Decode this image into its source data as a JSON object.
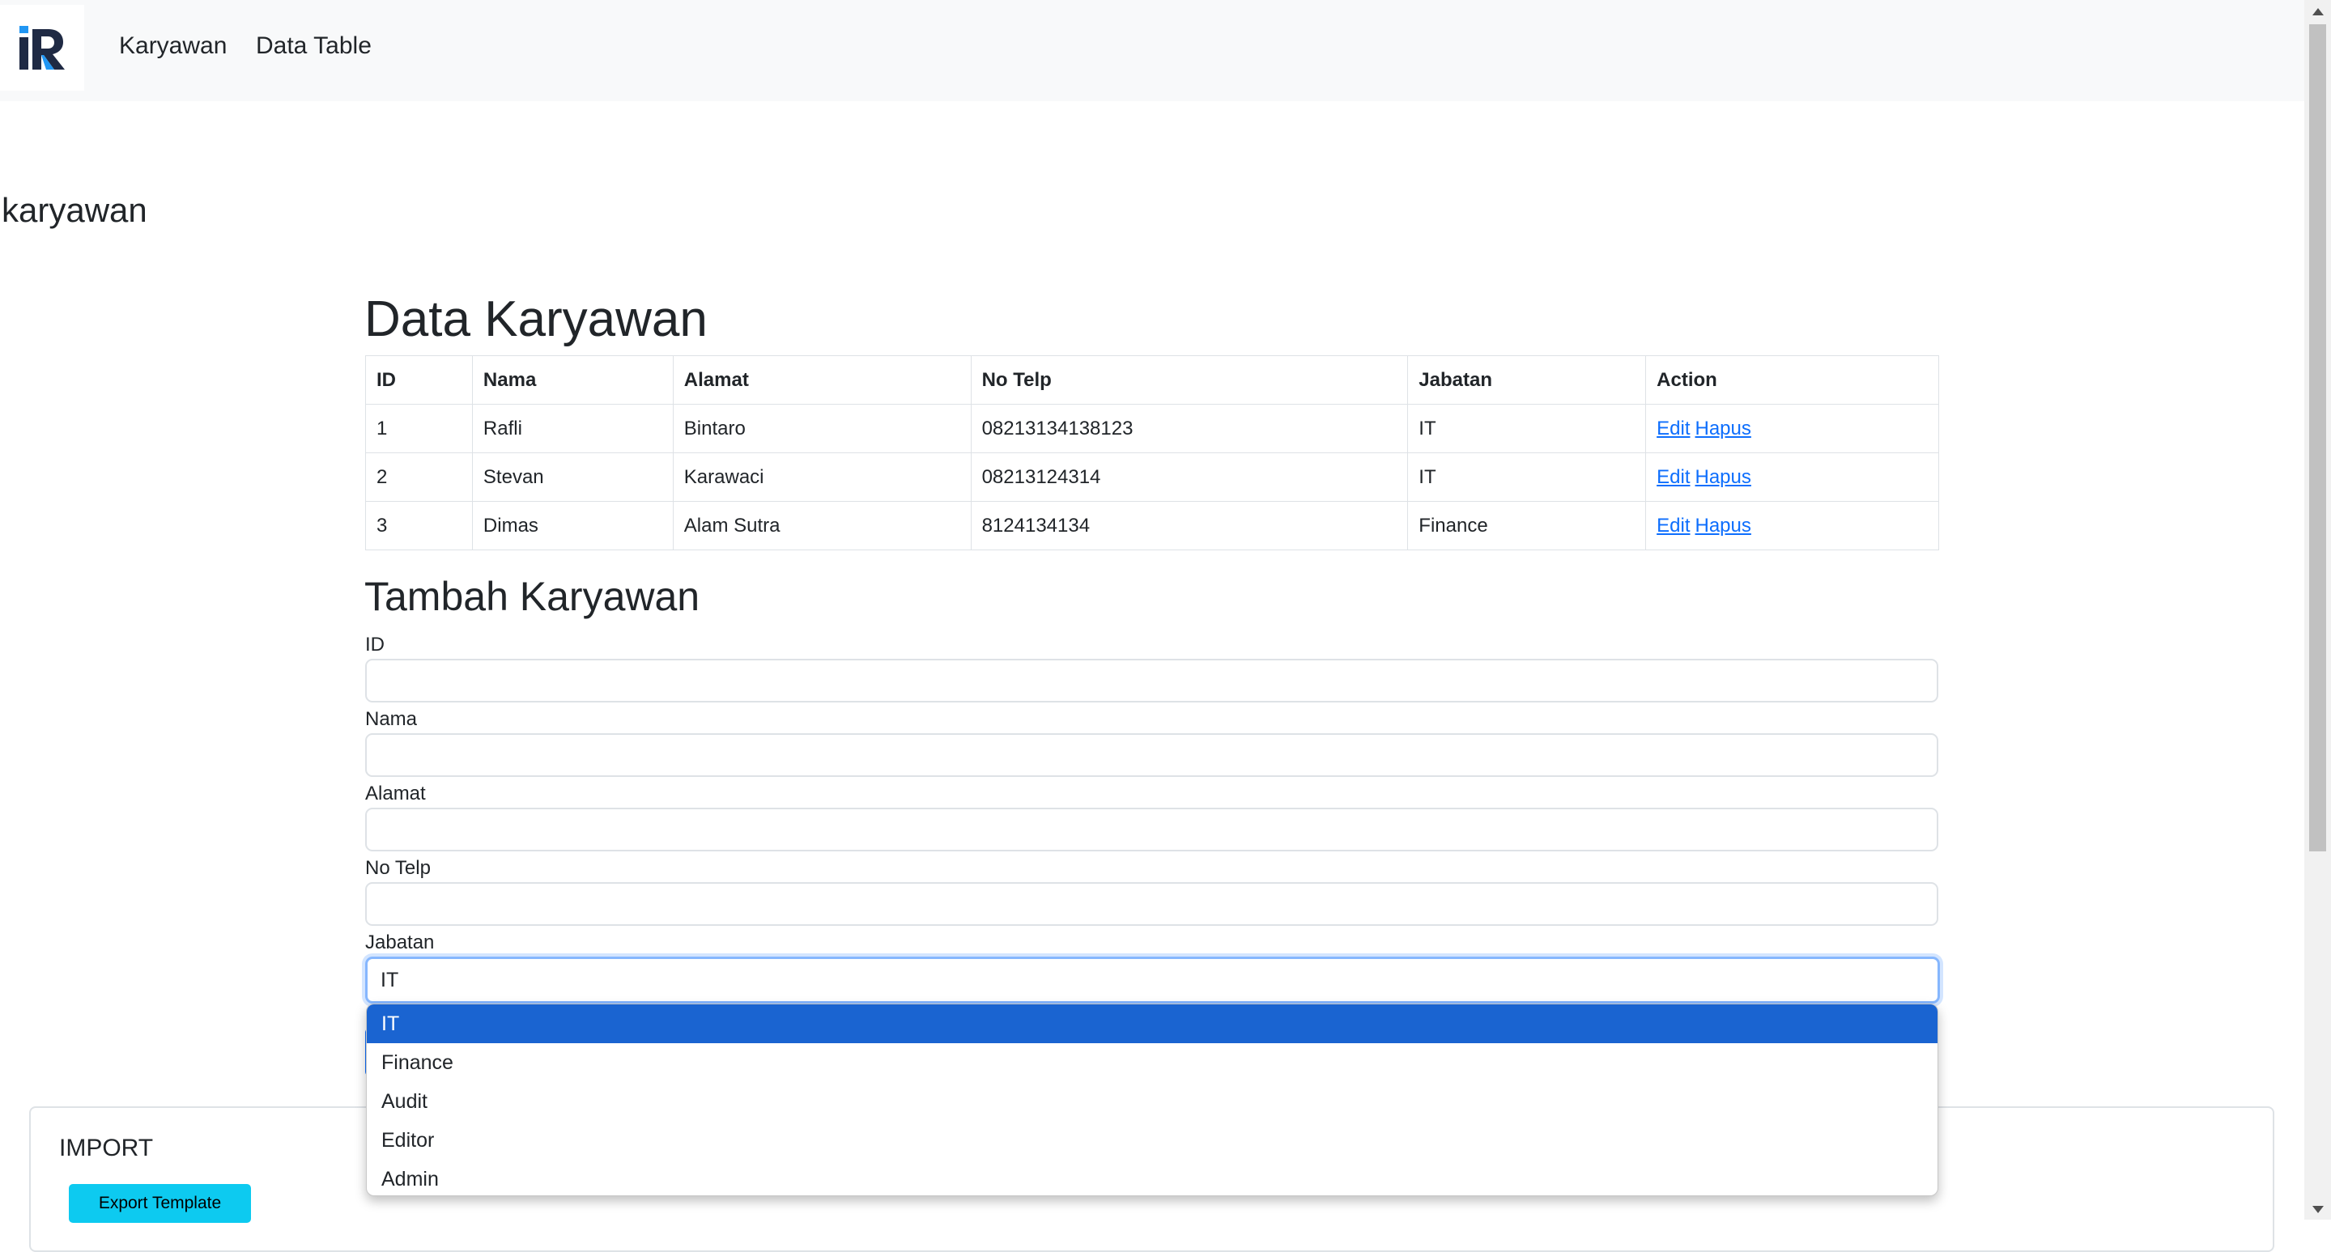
{
  "navbar": {
    "logo_text": "iR",
    "links": [
      "Karyawan",
      "Data Table"
    ]
  },
  "page_heading": "karyawan",
  "data_section": {
    "title": "Data Karyawan",
    "columns": [
      "ID",
      "Nama",
      "Alamat",
      "No Telp",
      "Jabatan",
      "Action"
    ],
    "rows": [
      {
        "id": "1",
        "nama": "Rafli",
        "alamat": "Bintaro",
        "no_telp": "08213134138123",
        "jabatan": "IT"
      },
      {
        "id": "2",
        "nama": "Stevan",
        "alamat": "Karawaci",
        "no_telp": "08213124314",
        "jabatan": "IT"
      },
      {
        "id": "3",
        "nama": "Dimas",
        "alamat": "Alam Sutra",
        "no_telp": "8124134134",
        "jabatan": "Finance"
      }
    ],
    "edit_label": "Edit",
    "delete_label": "Hapus"
  },
  "form": {
    "title": "Tambah Karyawan",
    "labels": {
      "id": "ID",
      "nama": "Nama",
      "alamat": "Alamat",
      "no_telp": "No Telp",
      "jabatan": "Jabatan"
    },
    "jabatan_value": "IT",
    "jabatan_options": [
      "IT",
      "Finance",
      "Audit",
      "Editor",
      "Admin"
    ],
    "selected_option": "IT"
  },
  "import": {
    "title": "IMPORT",
    "export_label": "Export Template"
  },
  "colors": {
    "link": "#0d6efd",
    "selected_option_bg": "#1a64d1",
    "export_button_bg": "#0dcaf0",
    "navbar_bg": "#f8f9fa"
  }
}
